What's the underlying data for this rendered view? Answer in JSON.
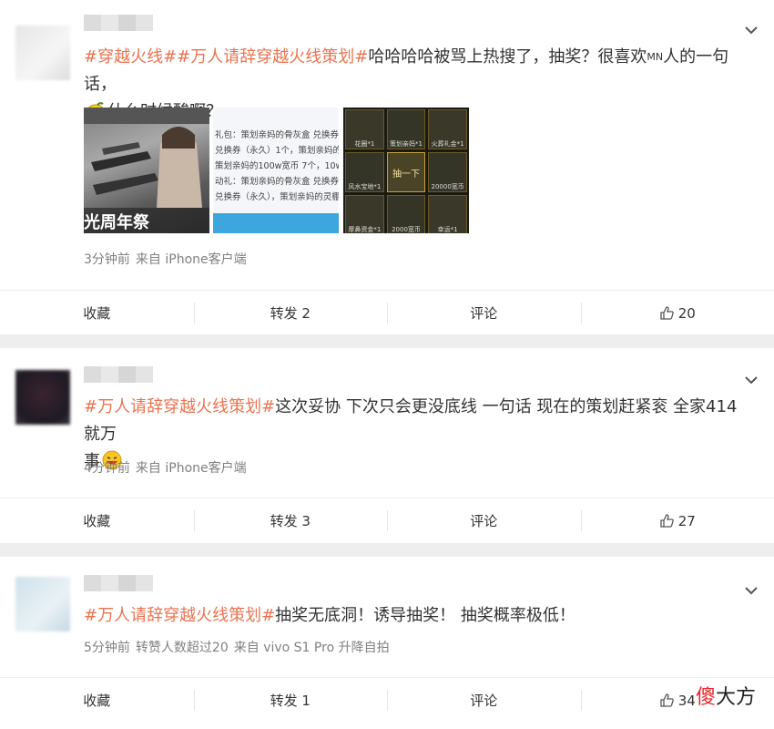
{
  "posts": [
    {
      "text_tag1": "#穿越火线#",
      "text_tag2": "#万人请辞穿越火线策划#",
      "text_body1": "哈哈哈哈被骂上热搜了，抽奖？很喜欢",
      "text_mn": "MN",
      "text_body2": "人的一句话，",
      "text_line2": "什么时候酸啊？",
      "images": [
        {
          "caption": "光周年祭"
        },
        {
          "lines": [
            "礼包：策划亲妈的骨灰盒 兑换券（永",
            "兑换券（永久）1个，策划亲妈的",
            "策划亲妈的100w宽币 7个，10w",
            "动礼：策划亲妈的骨灰盒 兑换券",
            "兑换券（永久），策划亲妈的灵棚"
          ]
        },
        {
          "center_label": "抽一下",
          "labels": [
            "花圈*1",
            "策划亲妈*1",
            "火葬礼金*1",
            "风水宝地*1",
            "20000宽币",
            "摩鼻资金*1",
            "狗托陪葬*10",
            "2000宽币",
            "幸运*1"
          ]
        }
      ],
      "time": "3分钟前",
      "source": "来自 iPhone客户端",
      "actions": {
        "collect": "收藏",
        "repost": "转发 2",
        "comment": "评论",
        "like": "20"
      }
    },
    {
      "text_tag": "#万人请辞穿越火线策划#",
      "text_body": "这次妥协 下次只会更没底线 一句话 现在的策划赶紧衮 全家414就万",
      "text_line2": "事",
      "time": "4分钟前",
      "source": "来自 iPhone客户端",
      "actions": {
        "collect": "收藏",
        "repost": "转发 3",
        "comment": "评论",
        "like": "27"
      }
    },
    {
      "text_tag": "#万人请辞穿越火线策划#",
      "text_body": "抽奖无底洞！诱导抽奖！ 抽奖概率极低！",
      "time": "5分钟前",
      "extra": "转赞人数超过20",
      "source": "来自 vivo S1 Pro 升降自拍",
      "actions": {
        "collect": "收藏",
        "repost": "转发 1",
        "comment": "评论",
        "like": "34"
      }
    }
  ],
  "watermark": {
    "a": "傻",
    "b": "大方"
  },
  "colors": {
    "tag": "#eb7350",
    "meta": "#808080",
    "bg": "#eeeeee"
  }
}
